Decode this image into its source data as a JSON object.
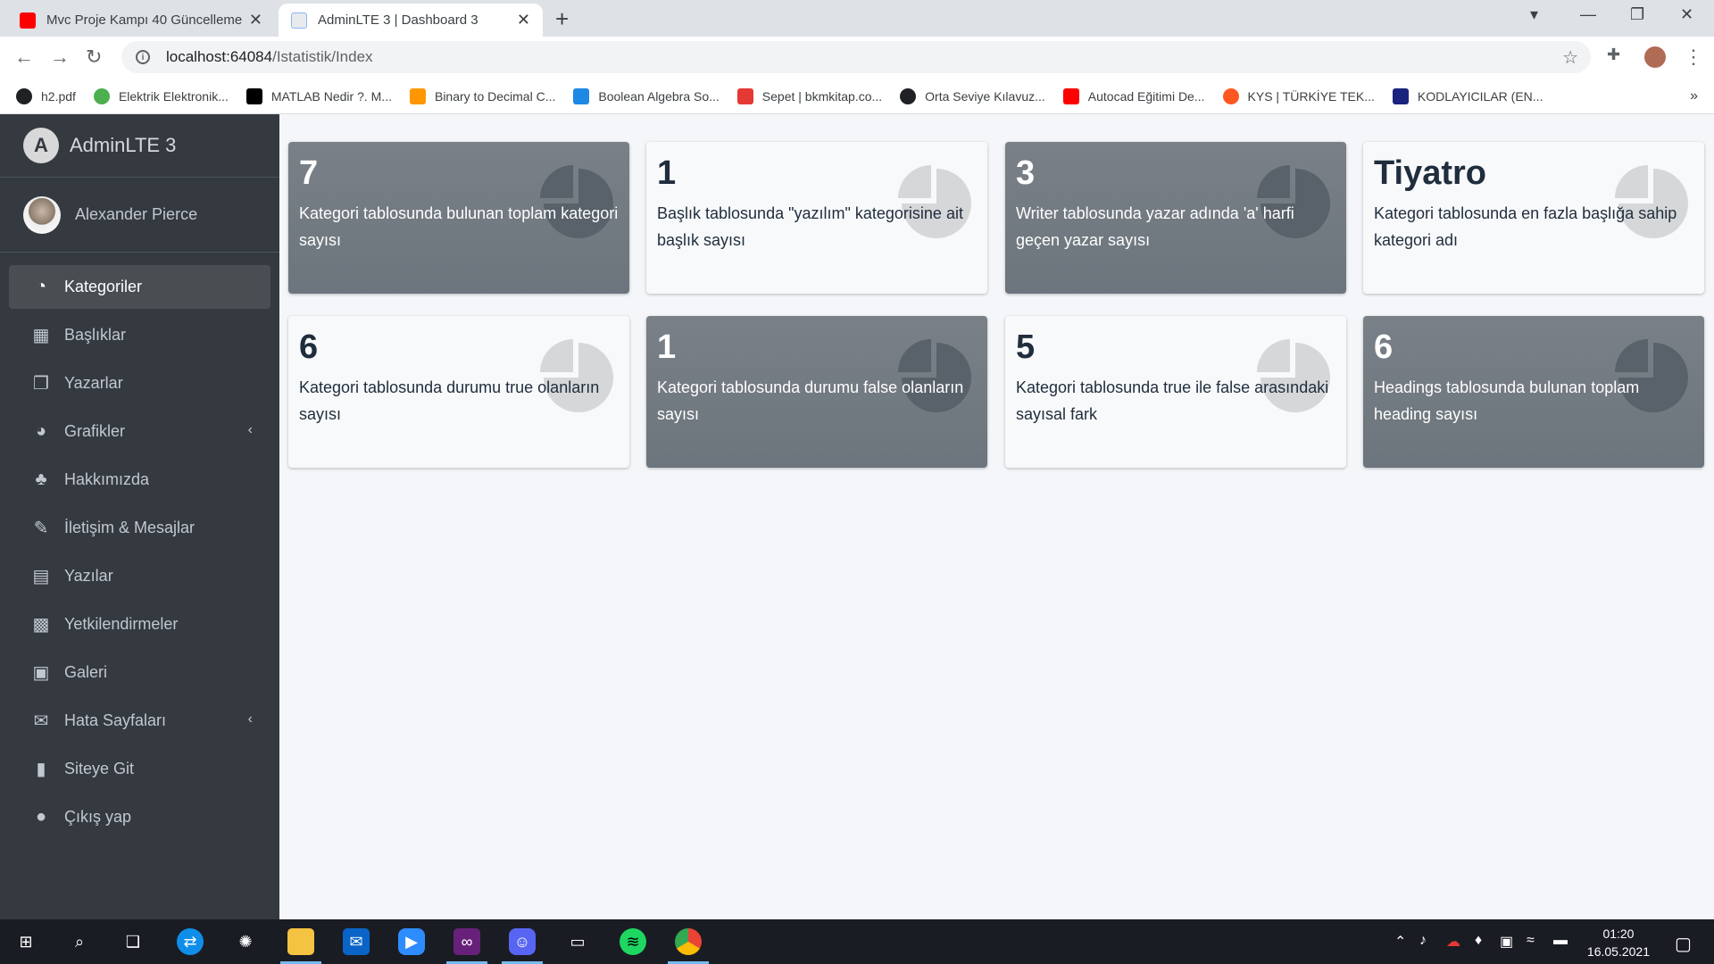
{
  "browser": {
    "tabs": [
      {
        "title": "Mvc Proje Kampı 40 Güncelleme",
        "favicon_color": "#ff0000",
        "close": "✕"
      },
      {
        "title": "AdminLTE 3 | Dashboard 3",
        "favicon_color": "#8ab4f8",
        "close": "✕"
      }
    ],
    "new_tab": "+",
    "url_host": "localhost:64084",
    "url_path": "/Istatistik/Index",
    "bookmarks": [
      {
        "label": "h2.pdf",
        "color": "#202124"
      },
      {
        "label": "Elektrik Elektronik...",
        "color": "#4caf50"
      },
      {
        "label": "MATLAB Nedir ?. M...",
        "color": "#000000"
      },
      {
        "label": "Binary to Decimal C...",
        "color": "#ff9800"
      },
      {
        "label": "Boolean Algebra So...",
        "color": "#1e88e5"
      },
      {
        "label": "Sepet | bkmkitap.co...",
        "color": "#e53935"
      },
      {
        "label": "Orta Seviye Kılavuz...",
        "color": "#202124"
      },
      {
        "label": "Autocad Eğitimi De...",
        "color": "#ff0000"
      },
      {
        "label": "KYS | TÜRKİYE TEK...",
        "color": "#ff5722"
      },
      {
        "label": "KODLAYICILAR (EN...",
        "color": "#1a237e"
      }
    ]
  },
  "sidebar": {
    "brand": "AdminLTE 3",
    "user": "Alexander Pierce",
    "items": [
      {
        "label": "Kategoriler",
        "icon": "tachometer-icon",
        "glyph": "◔",
        "active": true
      },
      {
        "label": "Başlıklar",
        "icon": "grid-icon",
        "glyph": "▦",
        "active": false
      },
      {
        "label": "Yazarlar",
        "icon": "copy-icon",
        "glyph": "❐",
        "active": false
      },
      {
        "label": "Grafikler",
        "icon": "pie-chart-icon",
        "glyph": "◕",
        "active": false,
        "chevron": "‹"
      },
      {
        "label": "Hakkımızda",
        "icon": "tree-icon",
        "glyph": "♣",
        "active": false
      },
      {
        "label": "İletişim & Mesajlar",
        "icon": "edit-icon",
        "glyph": "✎",
        "active": false
      },
      {
        "label": "Yazılar",
        "icon": "table-icon",
        "glyph": "▤",
        "active": false
      },
      {
        "label": "Yetkilendirmeler",
        "icon": "calendar-icon",
        "glyph": "▩",
        "active": false
      },
      {
        "label": "Galeri",
        "icon": "image-icon",
        "glyph": "▣",
        "active": false
      },
      {
        "label": "Hata Sayfaları",
        "icon": "envelope-icon",
        "glyph": "✉",
        "active": false,
        "chevron": "‹"
      },
      {
        "label": "Siteye Git",
        "icon": "book-icon",
        "glyph": "▮",
        "active": false
      },
      {
        "label": "Çıkış yap",
        "icon": "apple-icon",
        "glyph": "●",
        "active": false
      }
    ]
  },
  "cards": [
    {
      "value": "7",
      "text": "Kategori tablosunda bulunan toplam kategori sayısı",
      "style": "dark"
    },
    {
      "value": "1",
      "text": "Başlık tablosunda \"yazılım\" kategorisine ait başlık sayısı",
      "style": "light"
    },
    {
      "value": "3",
      "text": "Writer tablosunda yazar adında 'a' harfi geçen yazar sayısı",
      "style": "dark"
    },
    {
      "value": "Tiyatro",
      "text": "Kategori tablosunda en fazla başlığa sahip kategori adı",
      "style": "light"
    },
    {
      "value": "6",
      "text": "Kategori tablosunda durumu true olanların sayısı",
      "style": "light"
    },
    {
      "value": "1",
      "text": "Kategori tablosunda durumu false olanların sayısı",
      "style": "dark"
    },
    {
      "value": "5",
      "text": "Kategori tablosunda true ile false arasındaki sayısal fark",
      "style": "light"
    },
    {
      "value": "6",
      "text": "Headings tablosunda bulunan toplam heading sayısı",
      "style": "dark"
    }
  ],
  "taskbar": {
    "time": "01:20",
    "date": "16.05.2021"
  }
}
